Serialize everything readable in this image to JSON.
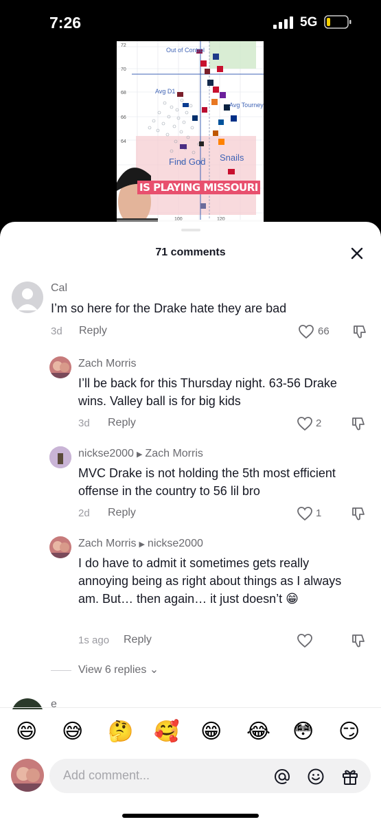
{
  "status_bar": {
    "time": "7:26",
    "network": "5G"
  },
  "video": {
    "y_ticks": [
      "72",
      "70",
      "68",
      "66",
      "64"
    ],
    "x_ticks": [
      "100",
      "120"
    ],
    "labels": {
      "top_left": "Out of Control",
      "avg_d1": "Avg D1",
      "avg_tourney": "Avg Tourney",
      "snails": "Snails",
      "find_god": "Find God"
    },
    "caption": "IS PLAYING MISSOURI"
  },
  "sheet": {
    "title": "71 comments"
  },
  "comments": [
    {
      "user": "Cal",
      "text": "I’m so here for the Drake hate they are bad",
      "age": "3d",
      "reply": "Reply",
      "likes": "66"
    },
    {
      "user": "Zach Morris",
      "text": "I’ll be back for this Thursday night. 63-56 Drake wins. Valley ball is for big kids",
      "age": "3d",
      "reply": "Reply",
      "likes": "2"
    },
    {
      "user": "nickse2000",
      "reply_to": "Zach Morris",
      "text": "MVC Drake is not holding the 5th most efficient offense in the country to 56 lil bro",
      "age": "2d",
      "reply": "Reply",
      "likes": "1"
    },
    {
      "user": "Zach Morris",
      "reply_to": "nickse2000",
      "text": "I do have to admit it sometimes gets really annoying being as right about things as I always am. But… then again… it just doesn’t 😁",
      "age": "1s ago",
      "reply": "Reply",
      "likes": ""
    },
    {
      "user": "e"
    }
  ],
  "view_replies": "View 6 replies",
  "emojis": [
    "😄",
    "😅",
    "🤔",
    "🥰",
    "😁",
    "😂",
    "😳",
    "😏"
  ],
  "input": {
    "placeholder": "Add comment..."
  },
  "colors": {
    "caption_bg": "#e8506e",
    "text": "#161823",
    "muted": "#6b6b70"
  }
}
